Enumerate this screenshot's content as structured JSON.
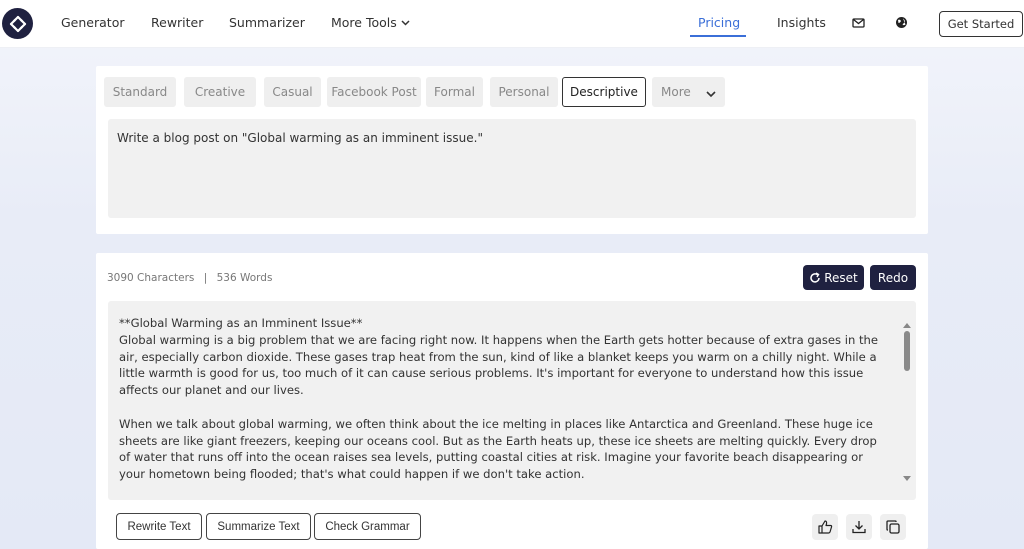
{
  "nav": {
    "links": {
      "generator": "Generator",
      "rewriter": "Rewriter",
      "summarizer": "Summarizer",
      "more_tools": "More Tools",
      "pricing": "Pricing",
      "insights": "Insights"
    },
    "get_started": "Get Started",
    "accent_color": "#3b6fd8"
  },
  "tabs": [
    "Standard",
    "Creative",
    "Casual",
    "Facebook Post",
    "Formal",
    "Personal",
    "Descriptive",
    "More"
  ],
  "active_tab": "Descriptive",
  "prompt": "Write a blog post on \"Global warming as an imminent issue.\"",
  "stats": {
    "characters": "3090 Characters",
    "separator": "|",
    "words": "536 Words"
  },
  "buttons": {
    "reset": "Reset",
    "redo": "Redo",
    "rewrite": "Rewrite Text",
    "summarize": "Summarize Text",
    "grammar": "Check Grammar"
  },
  "output": {
    "title": "**Global Warming as an Imminent Issue**",
    "para1": "Global warming is a big problem that we are facing right now. It happens when the Earth gets hotter because of extra gases in the air, especially carbon dioxide. These gases trap heat from the sun, kind of like a blanket keeps you warm on a chilly night. While a little warmth is good for us, too much of it can cause serious problems. It's important for everyone to understand how this issue affects our planet and our lives.",
    "para2": "When we talk about global warming, we often think about the ice melting in places like Antarctica and Greenland. These huge ice sheets are like giant freezers, keeping our oceans cool. But as the Earth heats up, these ice sheets are melting quickly. Every drop of water that runs off into the ocean raises sea levels, putting coastal cities at risk. Imagine your favorite beach disappearing or your hometown being flooded; that's what could happen if we don't take action."
  },
  "icons": [
    "logo-icon",
    "mail-icon",
    "globe-icon",
    "reset-icon",
    "thumbs-up-icon",
    "download-icon",
    "copy-icon",
    "chevron-down-icon"
  ],
  "colors": {
    "dark_button": "#1f2140"
  }
}
